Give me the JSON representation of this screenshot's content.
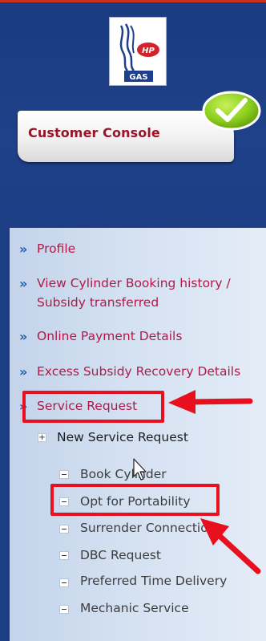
{
  "logo": {
    "brand_text": "HP",
    "sub_text": "GAS"
  },
  "banner": {
    "title": "Customer Console"
  },
  "menu": {
    "items": [
      {
        "label_lines": [
          "Profile"
        ]
      },
      {
        "label_lines": [
          "View Cylinder Booking history /",
          "Subsidy transferred"
        ]
      },
      {
        "label_lines": [
          "Online Payment Details"
        ]
      },
      {
        "label_lines": [
          "Excess Subsidy Recovery Details"
        ]
      },
      {
        "label_lines": [
          "Service Request"
        ]
      }
    ],
    "group": {
      "label": "New Service Request"
    },
    "sub_items": [
      "Book Cylinder",
      "Opt for Portability",
      "Surrender Connection",
      "DBC Request",
      "Preferred Time Delivery",
      "Mechanic Service"
    ]
  },
  "colors": {
    "page_background": "#1d3e85",
    "menu_text": "#b01a48",
    "banner_text": "#9a1428",
    "annotation_red": "#e8101e",
    "check_badge": "#8ccf1e"
  },
  "icons": {
    "menu_bullet": "double-chevron-icon",
    "expand": "plus-box-icon",
    "collapse": "minus-box-icon",
    "badge": "checkmark-icon",
    "pointer": "mouse-cursor-icon"
  }
}
